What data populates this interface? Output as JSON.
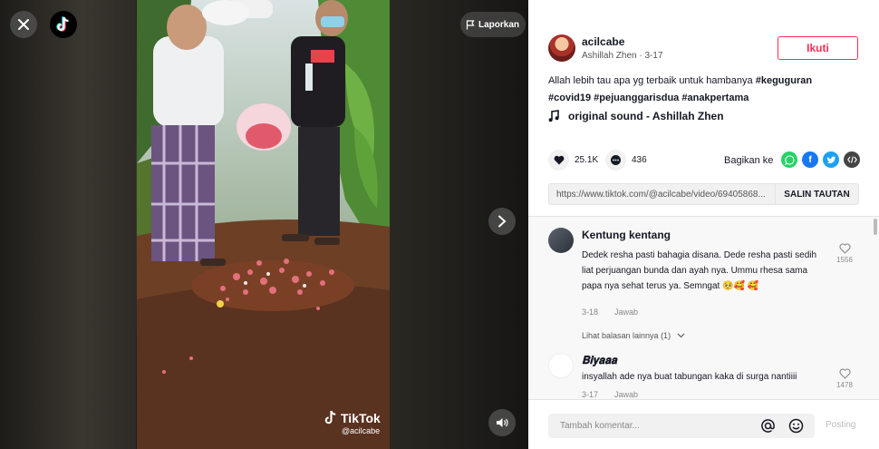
{
  "video": {
    "report_label": "Laporkan",
    "watermark_brand": "TikTok",
    "watermark_handle": "@acilcabe"
  },
  "author": {
    "username": "acilcabe",
    "display_name": "Ashillah Zhen",
    "separator": "·",
    "date": "3-17",
    "follow_label": "Ikuti"
  },
  "caption": {
    "text": "Allah lebih tau apa yg terbaik untuk hambanya",
    "hashtags": [
      "#keguguran",
      "#covid19",
      "#pejuanggarisdua",
      "#anakpertama"
    ]
  },
  "music": {
    "title": "original sound - Ashillah Zhen"
  },
  "actions": {
    "likes": "25.1K",
    "comments": "436",
    "share_label": "Bagikan ke",
    "share_targets": [
      "whatsapp-icon",
      "facebook-icon",
      "twitter-icon",
      "embed-icon"
    ]
  },
  "link": {
    "url": "https://www.tiktok.com/@acilcabe/video/69405868...",
    "copy_label": "SALIN TAUTAN"
  },
  "comments": [
    {
      "name": "Kentung kentang",
      "text": "Dedek resha pasti bahagia disana. Dede resha pasti sedih liat perjuangan bunda dan ayah nya. Ummu rhesa sama papa nya sehat terus ya. Semngat 🥺🥰 🥰",
      "date": "3-18",
      "reply_label": "Jawab",
      "likes": "1556",
      "more_replies": "Lihat balasan lainnya (1)"
    },
    {
      "name": "𝐁𝐢𝐲𝐚𝐚𝐚",
      "text": "insyallah ade nya buat tabungan kaka di surga nantiiii",
      "date": "3-17",
      "reply_label": "Jawab",
      "likes": "1478"
    }
  ],
  "composer": {
    "placeholder": "Tambah komentar...",
    "post_label": "Posting"
  },
  "colors": {
    "accent": "#fe2c55",
    "whatsapp": "#25d366",
    "facebook": "#1877f2",
    "twitter": "#1da1f2",
    "embed": "#444444"
  }
}
